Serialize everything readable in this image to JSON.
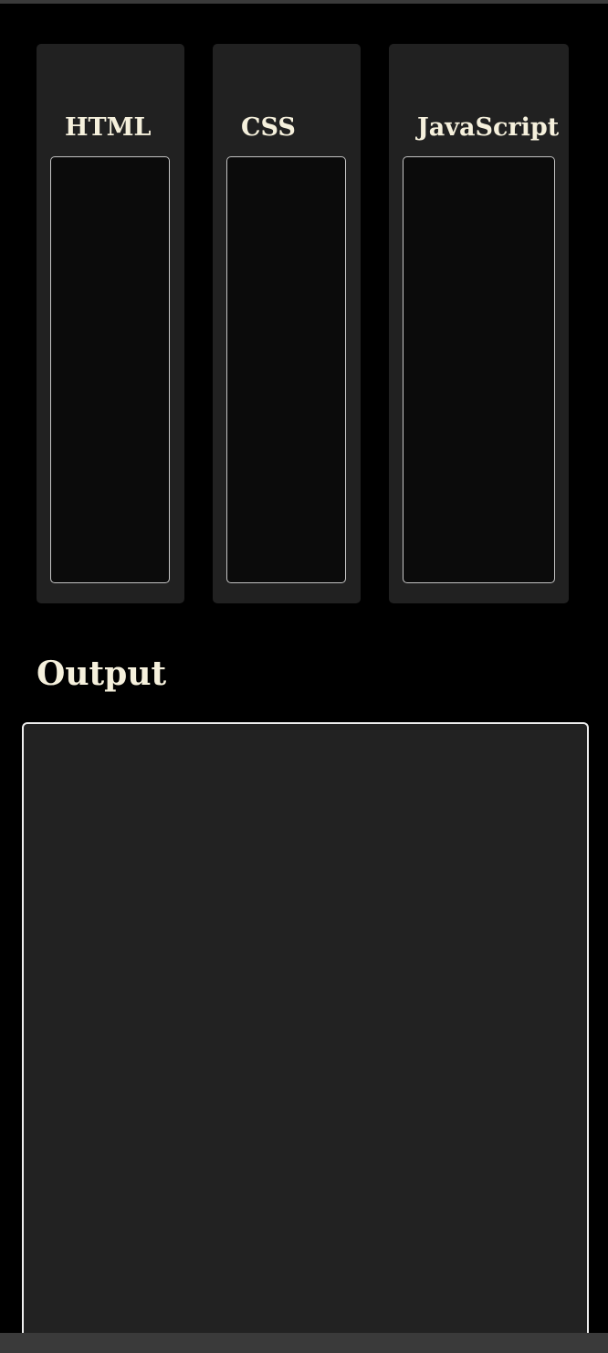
{
  "editors": {
    "html": {
      "title": "HTML",
      "value": ""
    },
    "css": {
      "title": "CSS",
      "value": ""
    },
    "js": {
      "title": "JavaScript",
      "value": ""
    }
  },
  "output": {
    "title": "Output"
  },
  "colors": {
    "background": "#000000",
    "panel": "#212121",
    "editor": "#0b0b0b",
    "editor_border": "#c4c4c4",
    "heading": "#f5f0dc",
    "output_frame": "#222222"
  }
}
